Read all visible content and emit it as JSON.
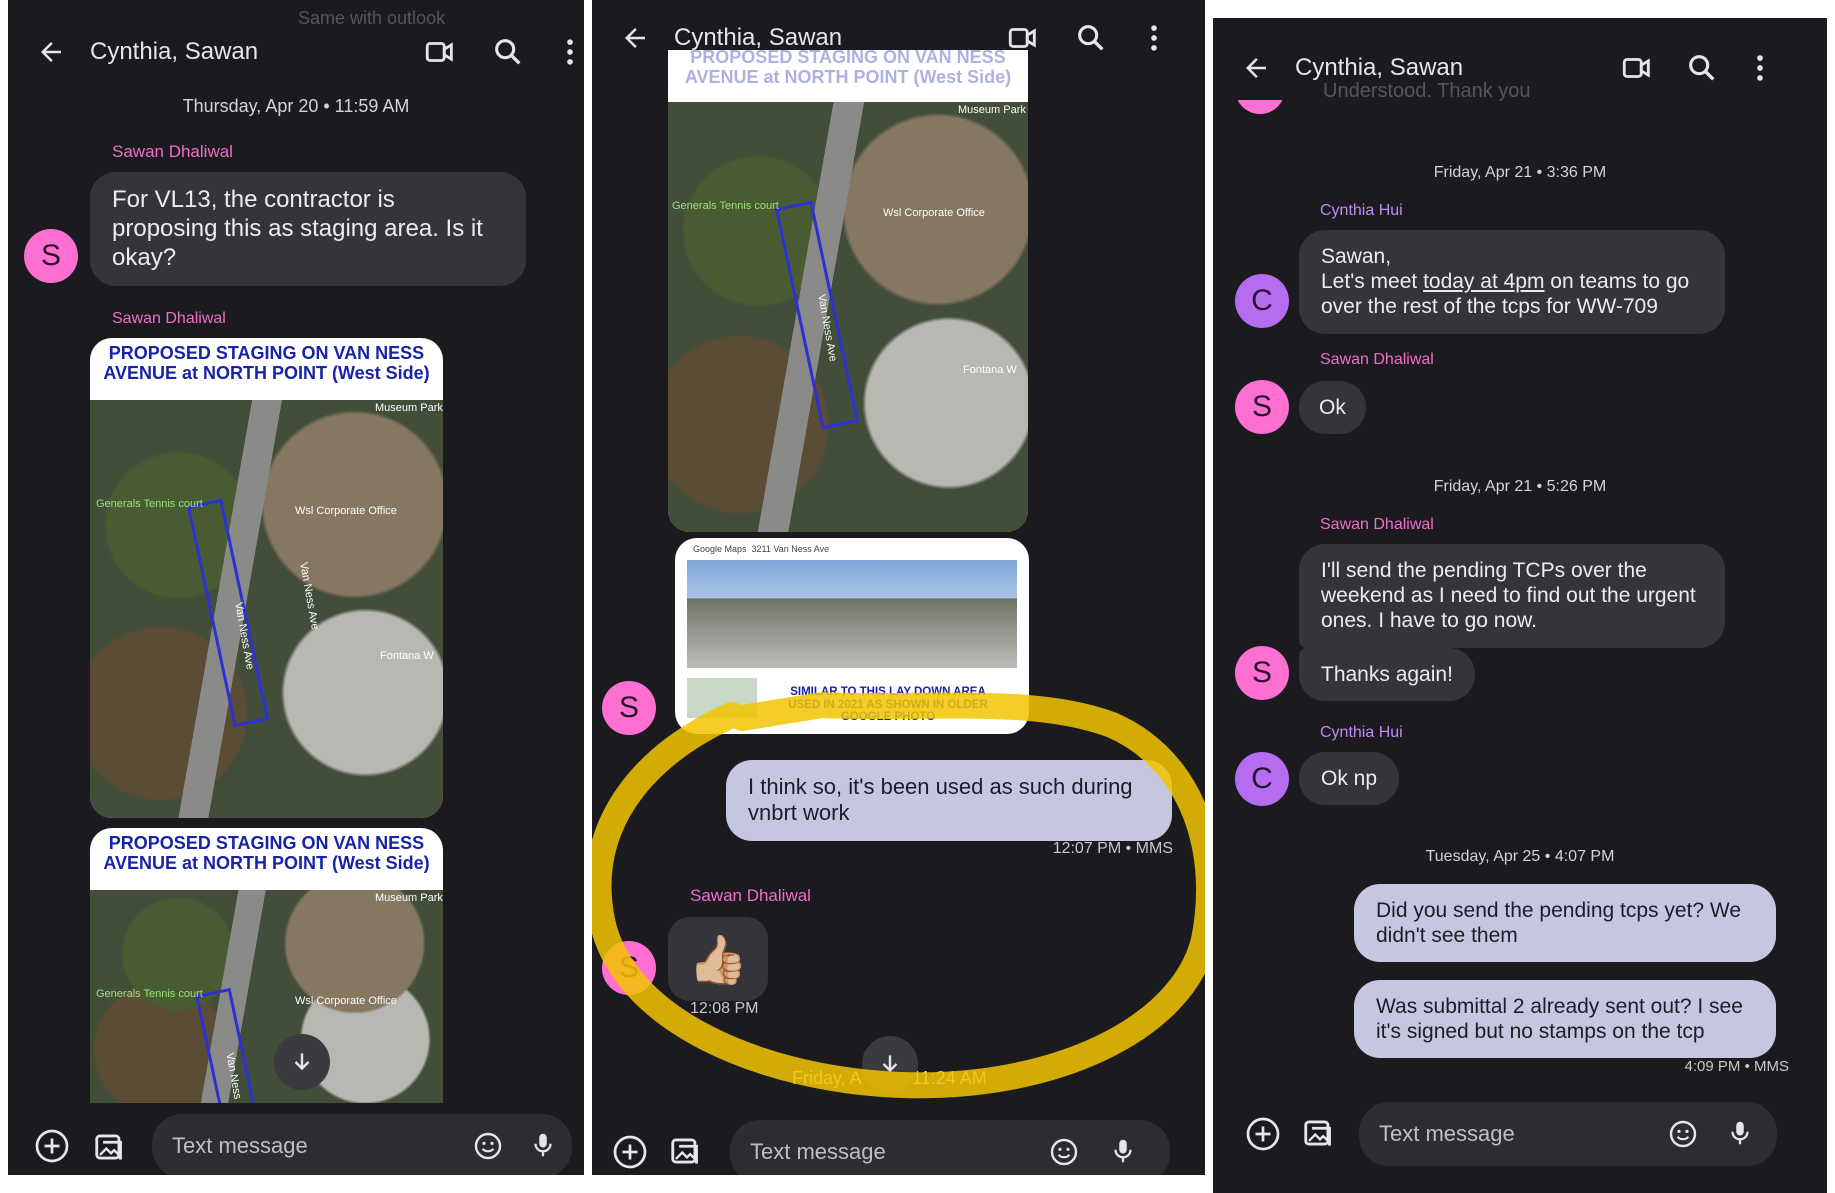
{
  "conversation_title": "Cynthia, Sawan",
  "compose_placeholder": "Text message",
  "panel1": {
    "ghost_text": "Same with outlook",
    "date_header": "Thursday, Apr 20 • 11:59 AM",
    "msg1": {
      "sender": "Sawan Dhaliwal",
      "avatar": "S",
      "text": "For VL13, the contractor is proposing this as staging area. Is it okay?"
    },
    "msg2": {
      "sender": "Sawan Dhaliwal"
    },
    "image1": {
      "title": "PROPOSED STAGING ON VAN NESS AVENUE at NORTH POINT (West Side)",
      "labels": [
        "Van Ness Ave",
        "Van Ness Ave",
        "Wsl Corporate Office",
        "Generals Tennis court",
        "Museum Park",
        "Fontana W"
      ]
    },
    "image2": {
      "title": "PROPOSED STAGING ON VAN NESS AVENUE at NORTH POINT (West Side)",
      "labels": [
        "Van Ness",
        "Wsl Corporate Office",
        "Generals Tennis court",
        "Museum Park"
      ]
    }
  },
  "panel2": {
    "image_top": {
      "title": "PROPOSED STAGING ON VAN NESS AVENUE at NORTH POINT (West Side)",
      "labels": [
        "Van Ness Ave",
        "Wsl Corporate Office",
        "Generals Tennis court",
        "Museum Park",
        "Fontana W"
      ]
    },
    "image_street": {
      "caption": "SIMILAR TO THIS LAY DOWN AREA USED IN 2021 AS SHOWN IN OLDER GOOGLE PHOTO",
      "maps_label": "Google Maps",
      "address": "3211 Van Ness Ave"
    },
    "sender_avatar": "S",
    "out_msg": {
      "text": "I think so, it's been used as such during vnbrt work",
      "meta": "12:07 PM • MMS"
    },
    "reply": {
      "sender": "Sawan Dhaliwal",
      "emoji": "👍🏼",
      "time": "12:08 PM"
    },
    "date_header": "Friday, Apr 21 • 11:24 AM",
    "date_left": "Friday, A",
    "date_right": "11:24 AM"
  },
  "panel3": {
    "ghost_text": "Understood. Thank you",
    "date1": "Friday, Apr 21 • 3:36 PM",
    "m1": {
      "sender": "Cynthia Hui",
      "avatar": "C",
      "line1": "Sawan,",
      "line2_a": "Let's meet ",
      "line2_link": "today at 4pm",
      "line2_b": " on teams to go",
      "line3": "over the rest of the tcps for WW-709"
    },
    "m2": {
      "sender": "Sawan Dhaliwal",
      "avatar": "S",
      "text": "Ok"
    },
    "date2": "Friday, Apr 21 • 5:26 PM",
    "m3": {
      "sender": "Sawan Dhaliwal",
      "avatar": "S",
      "text1": "I'll send the pending TCPs over the weekend as I need to find out the urgent ones. I have to go now.",
      "text2": "Thanks again!"
    },
    "m4": {
      "sender": "Cynthia Hui",
      "avatar": "C",
      "text": "Ok np"
    },
    "date3": "Tuesday, Apr 25 • 4:07 PM",
    "o1": {
      "text": "Did you send the pending tcps yet? We didn't see them"
    },
    "o2": {
      "text": "Was submittal 2 already sent out? I see it's signed but no stamps on the tcp",
      "meta": "4:09 PM • MMS"
    }
  },
  "colors": {
    "panel_bg": "#1b1b1f",
    "incoming_bubble": "#34343a",
    "outgoing_bubble": "#c5c6e0",
    "sawan_accent": "#f06ec7",
    "cynthia_accent": "#c38af3",
    "highlight": "#f2c400"
  },
  "icons": [
    "back-arrow-icon",
    "video-call-icon",
    "search-icon",
    "more-vert-icon",
    "add-icon",
    "gallery-icon",
    "emoji-icon",
    "mic-icon",
    "arrow-down-icon"
  ]
}
